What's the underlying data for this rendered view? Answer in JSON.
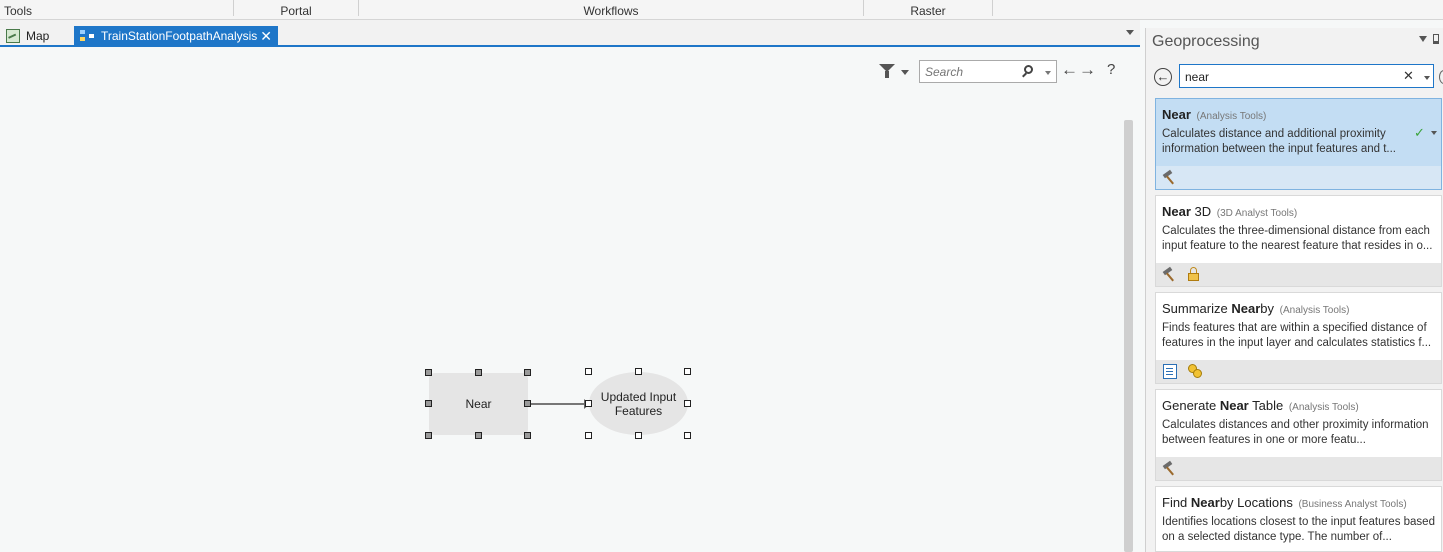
{
  "ribbon": {
    "groups": [
      "Tools",
      "Portal",
      "Workflows",
      "Raster"
    ]
  },
  "tabs": {
    "map_label": "Map",
    "model_label": "TrainStationFootpathAnalysis",
    "close_glyph": "✕"
  },
  "canvas": {
    "search_placeholder": "Search",
    "back_glyph": "←",
    "forward_glyph": "→",
    "help_glyph": "?",
    "nodes": {
      "tool_label": "Near",
      "output_label": "Updated Input Features"
    }
  },
  "geoprocessing": {
    "title": "Geoprocessing",
    "search_value": "near",
    "clear_glyph": "✕",
    "back_glyph": "←",
    "results": [
      {
        "pre": "",
        "match": "Near",
        "post": "",
        "category": "(Analysis Tools)",
        "desc": "Calculates distance and additional proximity information between the input features and t...",
        "selected": true,
        "check_glyph": "✓",
        "icons": [
          "hammer-icon"
        ]
      },
      {
        "pre": "",
        "match": "Near",
        "post": " 3D",
        "category": "(3D Analyst Tools)",
        "desc": "Calculates the three-dimensional distance from each input feature to the nearest feature that resides in o...",
        "icons": [
          "hammer-icon",
          "lock-icon"
        ]
      },
      {
        "pre": "Summarize ",
        "match": "Near",
        "post": "by",
        "category": "(Analysis Tools)",
        "desc": "Finds features that are within a specified distance of features in the input layer and calculates statistics f...",
        "icons": [
          "script-icon",
          "coins-icon"
        ]
      },
      {
        "pre": "Generate ",
        "match": "Near",
        "post": " Table",
        "category": "(Analysis Tools)",
        "desc": "Calculates distances and other proximity information between features in one or more featu...",
        "icons": [
          "hammer-icon"
        ]
      },
      {
        "pre": "Find ",
        "match": "Near",
        "post": "by Locations",
        "category": "(Business Analyst Tools)",
        "desc": "Identifies locations closest to the input features based on a selected distance type. The number of...",
        "icons": []
      }
    ]
  },
  "colors": {
    "accent": "#1e76c8",
    "selected_result": "#c3ddf3",
    "canvas_bg": "#f6f8f8"
  }
}
